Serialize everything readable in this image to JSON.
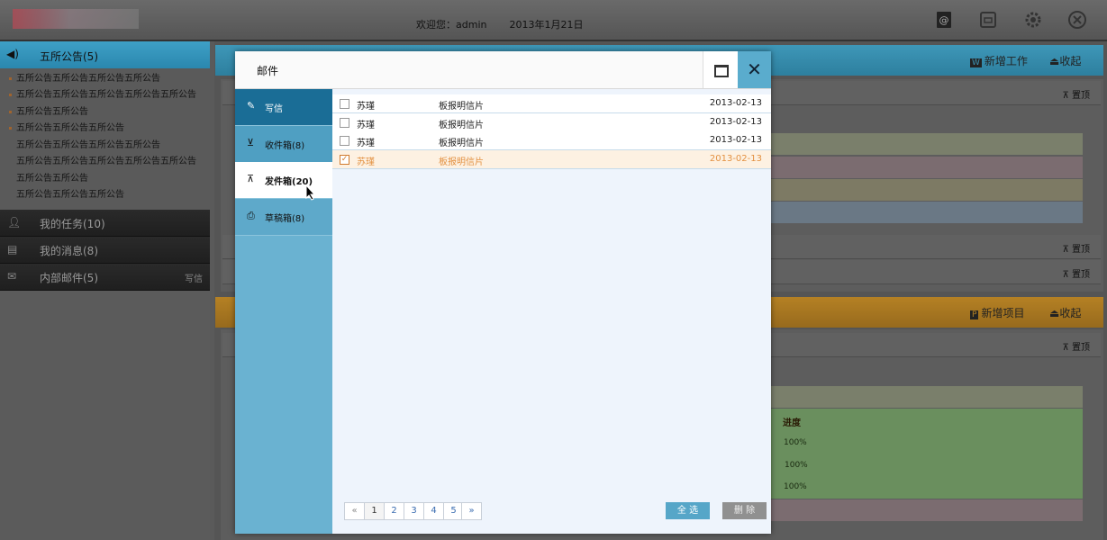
{
  "header": {
    "welcome": "欢迎您：admin",
    "date": "2013年1月21日",
    "icons": [
      "at-mail-icon",
      "archive-icon",
      "gear-icon",
      "close-circle-icon"
    ]
  },
  "sidebar": {
    "notice_title": "五所公告(5)",
    "notices": [
      "五所公告五所公告五所公告五所公告",
      "五所公告五所公告五所公告五所公告五所公告",
      "五所公告五所公告",
      "五所公告五所公告五所公告",
      "五所公告五所公告五所公告五所公告",
      "五所公告五所公告五所公告五所公告五所公告",
      "五所公告五所公告",
      "五所公告五所公告五所公告"
    ],
    "tasks": "我的任务(10)",
    "messages": "我的消息(8)",
    "mail": "内部邮件(5)",
    "mail_write": "写信"
  },
  "main": {
    "panel1": {
      "new_label": "新增工作",
      "collapse_label": "收起"
    },
    "panel2": {
      "new_label": "新增项目",
      "collapse_label": "收起"
    },
    "pin_label": "置顶",
    "progress_header": "进度",
    "progress_values": [
      "100%",
      "100%",
      "100%"
    ],
    "band_colors": [
      "#7a7f6b",
      "#7b6c70",
      "#7d7a64",
      "#6a7885",
      "#6a8f5e"
    ]
  },
  "dialog": {
    "title": "邮件",
    "nav": {
      "write": "写信",
      "inbox": "收件箱(8)",
      "sent": "发件箱(20)",
      "draft": "草稿箱(8)"
    },
    "mails": [
      {
        "from": "苏瑾",
        "subject": "板报明信片",
        "date": "2013-02-13",
        "checked": false
      },
      {
        "from": "苏瑾",
        "subject": "板报明信片",
        "date": "2013-02-13",
        "checked": false
      },
      {
        "from": "苏瑾",
        "subject": "板报明信片",
        "date": "2013-02-13",
        "checked": false
      },
      {
        "from": "苏瑾",
        "subject": "板报明信片",
        "date": "2013-02-13",
        "checked": true
      }
    ],
    "pager": {
      "prev": "«",
      "pages": [
        "1",
        "2",
        "3",
        "4",
        "5"
      ],
      "next": "»",
      "current": "1"
    },
    "select_all": "全 选",
    "delete": "删 除",
    "accent": "#5aaccd",
    "selected_color": "#e39142"
  }
}
